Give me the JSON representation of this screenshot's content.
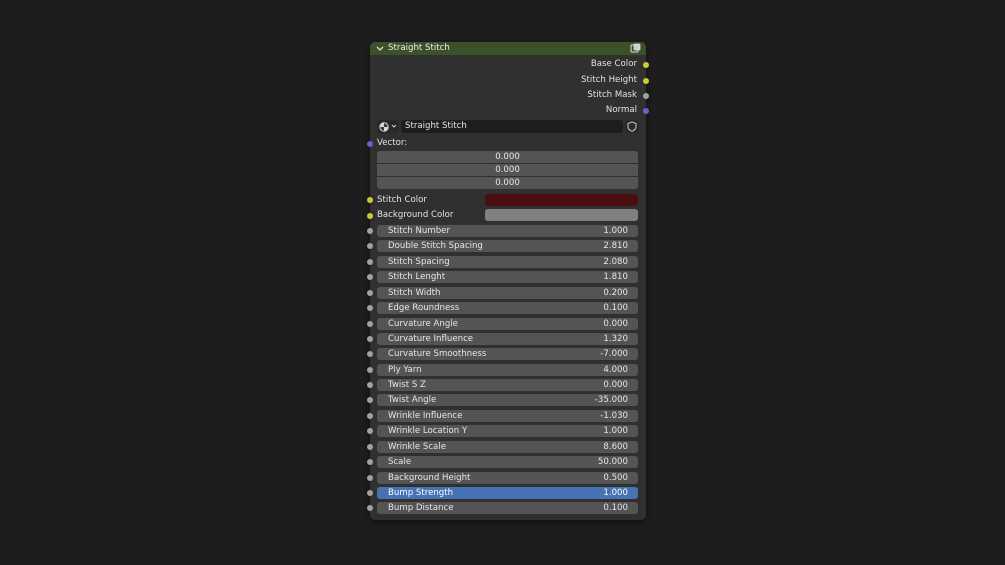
{
  "node": {
    "title": "Straight Stitch",
    "header_color": "#3b5228",
    "outputs": [
      {
        "label": "Base Color",
        "socket": "yellow"
      },
      {
        "label": "Stitch Height",
        "socket": "yellow"
      },
      {
        "label": "Stitch Mask",
        "socket": "gray"
      },
      {
        "label": "Normal",
        "socket": "purple"
      }
    ],
    "group_selector": {
      "type_icon": "sphere-icon",
      "value": "Straight Stitch",
      "shield_icon": "shield-icon"
    },
    "vector": {
      "label": "Vector:",
      "values": [
        "0.000",
        "0.000",
        "0.000"
      ]
    },
    "colors": [
      {
        "label": "Stitch Color",
        "value": "#4a0e10"
      },
      {
        "label": "Background Color",
        "value": "#808080"
      }
    ],
    "inputs": [
      {
        "label": "Stitch Number",
        "value": "1.000"
      },
      {
        "label": "Double Stitch Spacing",
        "value": "2.810"
      },
      {
        "label": "Stitch Spacing",
        "value": "2.080"
      },
      {
        "label": "Stitch Lenght",
        "value": "1.810"
      },
      {
        "label": "Stitch Width",
        "value": "0.200"
      },
      {
        "label": "Edge Roundness",
        "value": "0.100"
      },
      {
        "label": "Curvature Angle",
        "value": "0.000"
      },
      {
        "label": "Curvature Influence",
        "value": "1.320"
      },
      {
        "label": "Curvature Smoothness",
        "value": "-7.000"
      },
      {
        "label": "Ply Yarn",
        "value": "4.000"
      },
      {
        "label": "Twist S Z",
        "value": "0.000"
      },
      {
        "label": "Twist Angle",
        "value": "-35.000"
      },
      {
        "label": "Wrinkle Influence",
        "value": "-1.030"
      },
      {
        "label": "Wrinkle Location Y",
        "value": "1.000"
      },
      {
        "label": "Wrinkle Scale",
        "value": "8.600"
      },
      {
        "label": "Scale",
        "value": "50.000"
      },
      {
        "label": "Background Height",
        "value": "0.500"
      },
      {
        "label": "Bump Strength",
        "value": "1.000",
        "active": true
      },
      {
        "label": "Bump Distance",
        "value": "0.100"
      }
    ]
  }
}
